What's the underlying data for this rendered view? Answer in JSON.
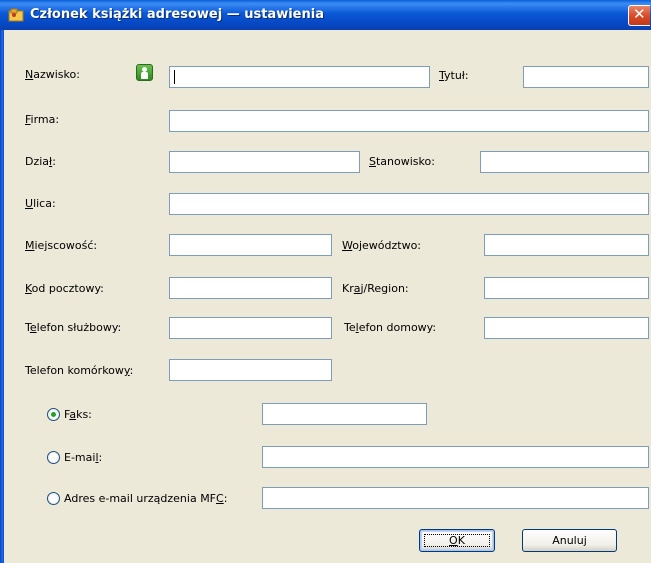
{
  "window": {
    "title": "Członek książki adresowej — ustawienia"
  },
  "fields": {
    "nazwisko": {
      "label_u": "N",
      "label_rest": "azwisko:",
      "value": ""
    },
    "tytul": {
      "label_u": "T",
      "label_rest": "ytuł:",
      "value": ""
    },
    "firma": {
      "label_u": "F",
      "label_rest": "irma:",
      "value": ""
    },
    "dzial": {
      "label_pre": "Dzia",
      "label_u": "ł",
      "label_rest": ":",
      "value": ""
    },
    "stanowisko": {
      "label_u": "S",
      "label_rest": "tanowisko:",
      "value": ""
    },
    "ulica": {
      "label_u": "U",
      "label_rest": "lica:",
      "value": ""
    },
    "miejscowosc": {
      "label_u": "M",
      "label_rest": "iejscowość:",
      "value": ""
    },
    "wojewodztwo": {
      "label_u": "W",
      "label_rest": "ojewództwo:",
      "value": ""
    },
    "kod": {
      "label_u": "K",
      "label_rest": "od pocztowy:",
      "value": ""
    },
    "kraj": {
      "label_pre": "Kr",
      "label_u": "a",
      "label_rest": "j/Region:",
      "value": ""
    },
    "tel_sluzbowy": {
      "label_pre": "T",
      "label_u": "e",
      "label_rest": "lefon służbowy:",
      "value": ""
    },
    "tel_domowy": {
      "label_pre": "Te",
      "label_u": "l",
      "label_rest": "efon domowy:",
      "value": ""
    },
    "tel_komorkowy": {
      "label_pre": "Telefon komórkow",
      "label_u": "y",
      "label_rest": ":",
      "value": ""
    }
  },
  "radios": {
    "faks": {
      "label_pre": "F",
      "label_u": "a",
      "label_rest": "ks:",
      "selected": true,
      "value": ""
    },
    "email": {
      "label_pre": "E-mai",
      "label_u": "l",
      "label_rest": ":",
      "selected": false,
      "value": ""
    },
    "mfc": {
      "label_pre": "Adres e-mail urządzenia MF",
      "label_u": "C",
      "label_rest": ":",
      "selected": false,
      "value": ""
    }
  },
  "buttons": {
    "ok_u": "O",
    "ok_rest": "K",
    "cancel": "Anuluj"
  }
}
